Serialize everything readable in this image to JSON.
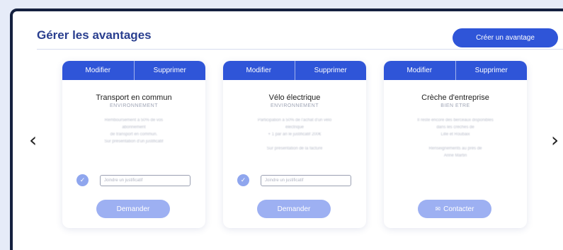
{
  "header": {
    "title": "Gérer les avantages",
    "create_label": "Créer un avantage"
  },
  "nav": {
    "prev_glyph": "‹",
    "next_glyph": "›"
  },
  "cards": [
    {
      "edit_label": "Modifier",
      "delete_label": "Supprimer",
      "title": "Transport en commun",
      "category": "ENVIRONNEMENT",
      "description": [
        "Remboursement à 50% de vos",
        "abonnement",
        "de transport en commun.",
        "Sur présentation d'un justificatif"
      ],
      "upload_placeholder": "Joindre un justificatif",
      "upload_icon": "check-icon",
      "action_label": "Demander"
    },
    {
      "edit_label": "Modifier",
      "delete_label": "Supprimer",
      "title": "Vélo électrique",
      "category": "ENVIRONNEMENT",
      "description": [
        "Participation à 50% de l'achat d'un vélo",
        "électrique",
        "+ 1 par an le justificatif 200€",
        "",
        "Sur présentation de la facture"
      ],
      "upload_placeholder": "Joindre un justificatif",
      "upload_icon": "check-icon",
      "action_label": "Demander"
    },
    {
      "edit_label": "Modifier",
      "delete_label": "Supprimer",
      "title": "Crèche d'entreprise",
      "category": "BIEN ETRE",
      "description": [
        "Il reste encore des berceaux disponibles",
        "dans les crèches de",
        "Lille et Roubaix",
        "",
        "Renseignements au près de",
        "Anne Martin"
      ],
      "action_label": "Contacter",
      "action_icon": "mail-icon"
    }
  ],
  "colors": {
    "primary": "#2f55d8",
    "primary_light": "#9db0f2",
    "title": "#2a3f8f",
    "frame": "#14203f"
  }
}
